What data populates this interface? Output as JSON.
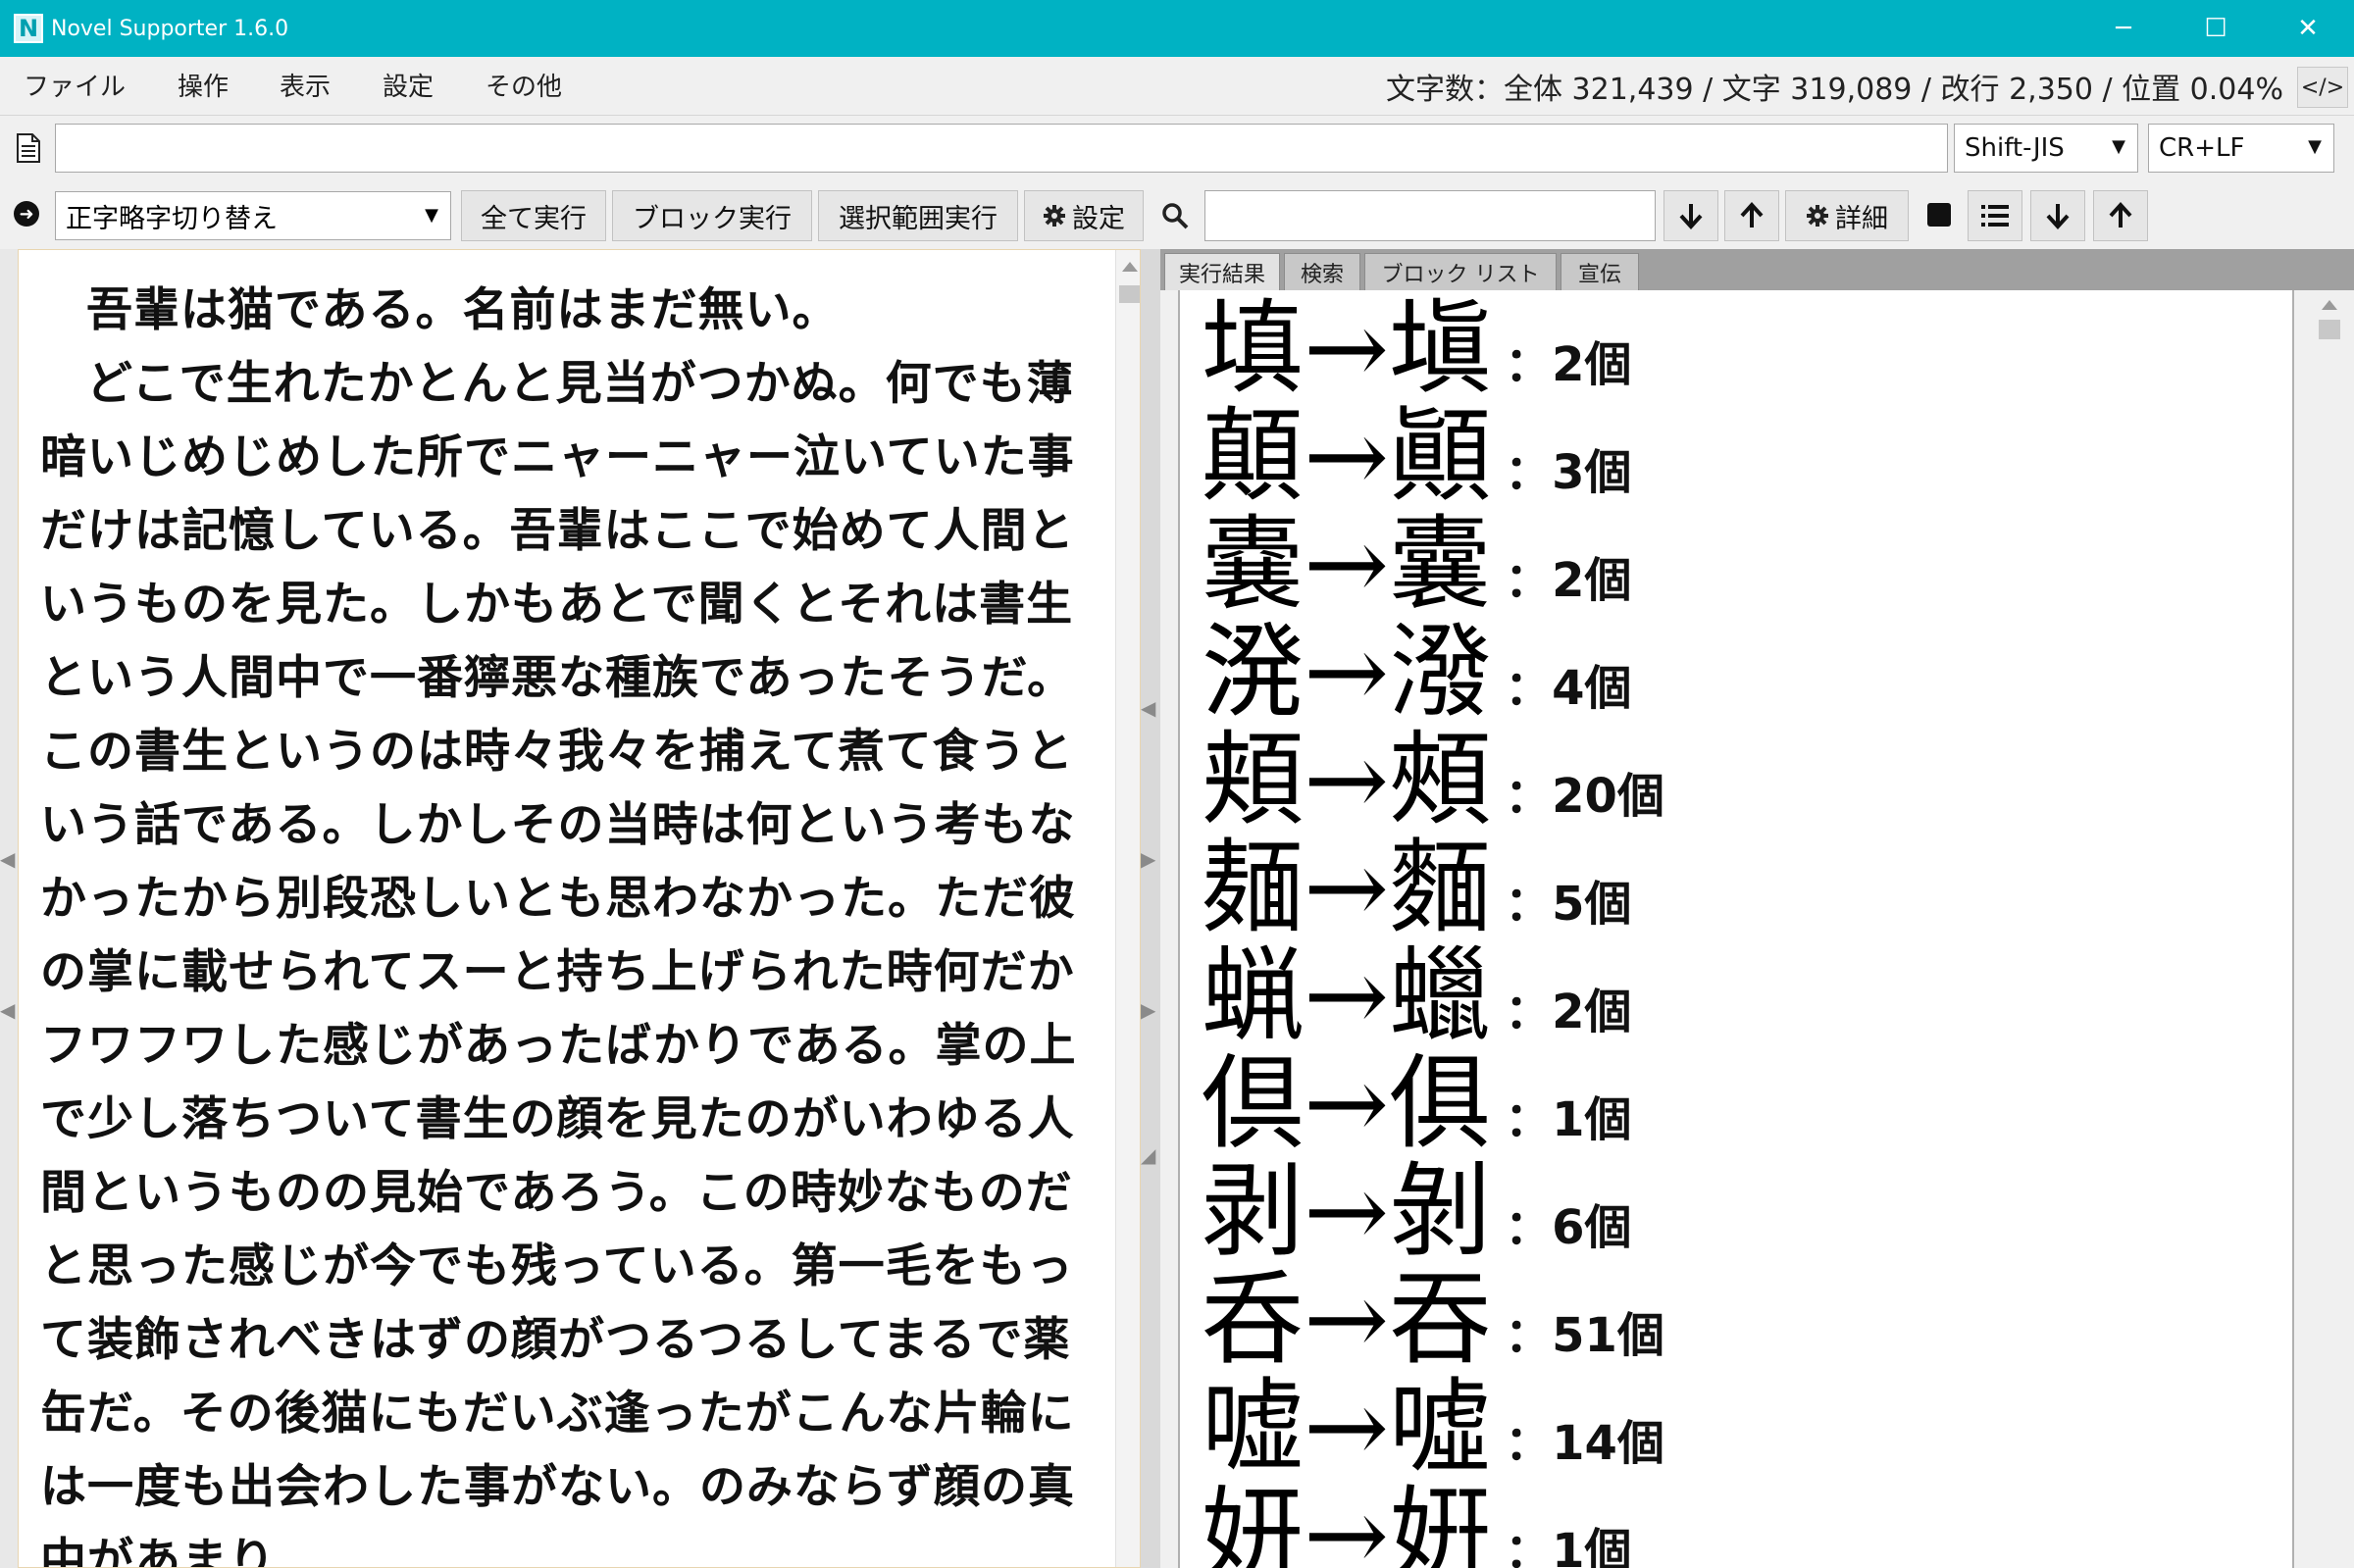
{
  "window": {
    "title": "Novel Supporter 1.6.0",
    "icon_letter": "N",
    "minimize": "─",
    "maximize": "☐",
    "close": "✕"
  },
  "menu": {
    "items": [
      "ファイル",
      "操作",
      "表示",
      "設定",
      "その他"
    ],
    "stats": "文字数：全体 321,439 / 文字 319,089 / 改行 2,350 / 位置 0.04%",
    "code_toggle": "</>"
  },
  "file": {
    "path": "",
    "encoding": "Shift-JIS",
    "newline": "CR+LF"
  },
  "toolbar": {
    "conversion": "正字略字切り替え",
    "run_all": "全て実行",
    "run_block": "ブロック実行",
    "run_selection": "選択範囲実行",
    "settings": "設定",
    "search_value": "",
    "details": "詳細"
  },
  "editor": {
    "paragraphs": [
      "吾輩は猫である。名前はまだ無い。",
      "どこで生れたかとんと見当がつかぬ。何でも薄暗いじめじめした所でニャーニャー泣いていた事だけは記憶している。吾輩はここで始めて人間というものを見た。しかもあとで聞くとそれは書生という人間中で一番獰悪な種族であったそうだ。この書生というのは時々我々を捕えて煮て食うという話である。しかしその当時は何という考もなかったから別段恐しいとも思わなかった。ただ彼の掌に載せられてスーと持ち上げられた時何だかフワフワした感じがあったばかりである。掌の上で少し落ちついて書生の顔を見たのがいわゆる人間というものの見始であろう。この時妙なものだと思った感じが今でも残っている。第一毛をもって装飾されべきはずの顔がつるつるしてまるで薬缶だ。その後猫にもだいぶ逢ったがこんな片輪には一度も出会わした事がない。のみならず顔の真中があまり"
    ]
  },
  "tabs": [
    "実行結果",
    "検索",
    "ブロック リスト",
    "宣伝"
  ],
  "results": [
    {
      "text": "填→塡",
      "count": "：2個"
    },
    {
      "text": "顛→顚",
      "count": "：3個"
    },
    {
      "text": "嚢→囊",
      "count": "：2個"
    },
    {
      "text": "溌→潑",
      "count": "：4個"
    },
    {
      "text": "頬→頰",
      "count": "：20個"
    },
    {
      "text": "麺→麵",
      "count": "：5個"
    },
    {
      "text": "蝋→蠟",
      "count": "：2個"
    },
    {
      "text": "倶→俱",
      "count": "：1個"
    },
    {
      "text": "剥→剝",
      "count": "：6個"
    },
    {
      "text": "呑→吞",
      "count": "：51個"
    },
    {
      "text": "嘘→噓",
      "count": "：14個"
    },
    {
      "text": "妍→姸",
      "count": "：1個"
    }
  ]
}
